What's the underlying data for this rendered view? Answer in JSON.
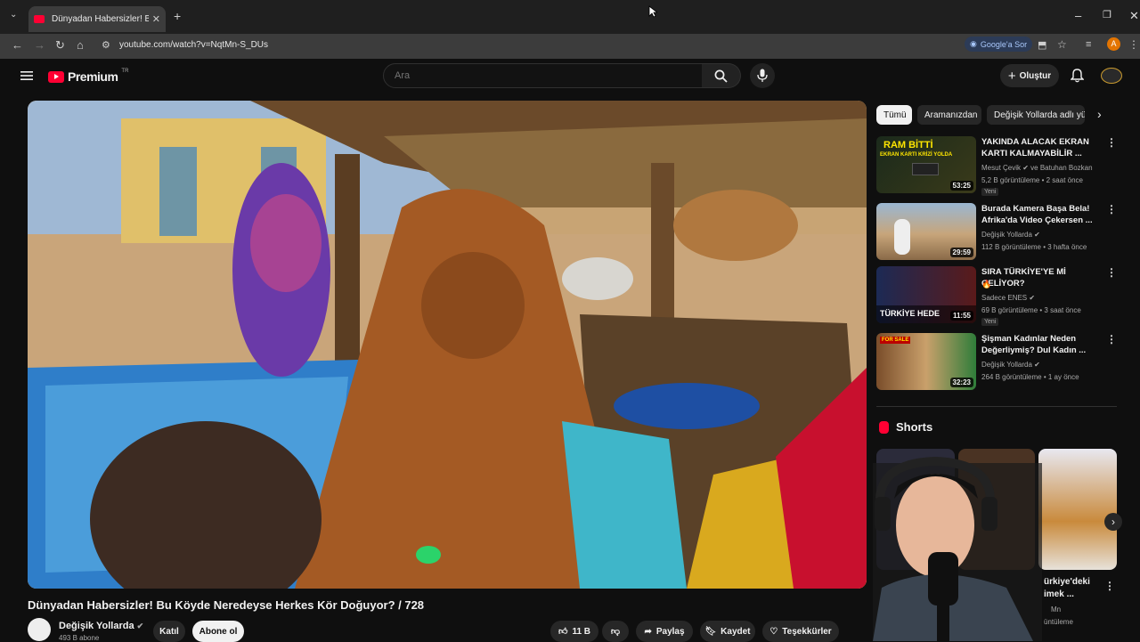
{
  "browser": {
    "tab_title": "Dünyadan Habersizler! Bu Köyde",
    "tab_close": "✕",
    "new_tab": "+",
    "url": "youtube.com/watch?v=NqtMn-S_DUs",
    "google_sor": "Google'a Sor",
    "profile_letter": "A"
  },
  "youtube": {
    "brand": "Premium",
    "brand_region": "TR",
    "search_placeholder": "Ara",
    "create_label": "Oluştur"
  },
  "video": {
    "title": "Dünyadan Habersizler! Bu Köyde Neredeyse Herkes Kör Doğuyor? / 728",
    "channel": "Değişik Yollarda",
    "subscribers": "493 B abone",
    "join_label": "Katıl",
    "subscribe_label": "Abone ol",
    "likes": "11 B",
    "share_label": "Paylaş",
    "save_label": "Kaydet",
    "thanks_label": "Teşekkürler"
  },
  "chips": [
    "Tümü",
    "Aramanızdan",
    "Değişik Yollarda adlı yük"
  ],
  "recommendations": [
    {
      "title": "YAKINDA ALACAK EKRAN KARTI KALMAYABİLİR ...",
      "channel": "Mesut Çevik",
      "collab": "ve Batuhan Bozkan",
      "meta": "5,2 B görüntüleme • 2 saat önce",
      "badge": "Yeni",
      "duration": "53:25",
      "thumb_text_1": "RAM BİTTİ",
      "thumb_text_2": "EKRAN KARTI KRİZİ YOLDA"
    },
    {
      "title": "Burada Kamera Başa Bela! Afrika'da Video Çekersen ...",
      "channel": "Değişik Yollarda",
      "collab": "",
      "meta": "112 B görüntüleme • 3 hafta önce",
      "badge": "",
      "duration": "29:59",
      "thumb_text_1": "",
      "thumb_text_2": ""
    },
    {
      "title": "SIRA TÜRKİYE'YE Mİ GELİYOR?",
      "channel": "Sadece ENES",
      "collab": "",
      "meta": "69 B görüntüleme • 3 saat önce",
      "badge": "Yeni",
      "duration": "11:55",
      "thumb_text_1": "TÜRKİYE HEDE",
      "thumb_text_2": ""
    },
    {
      "title": "Şişman Kadınlar Neden Değerliymiş? Dul Kadın ...",
      "channel": "Değişik Yollarda",
      "collab": "",
      "meta": "264 B görüntüleme • 1 ay önce",
      "badge": "",
      "duration": "32:23",
      "thumb_text_1": "FOR SALE",
      "thumb_text_2": ""
    }
  ],
  "shorts": {
    "heading": "Shorts",
    "partial_title_1": "ürkiye'deki",
    "partial_title_2": "imek ...",
    "partial_channel": "Mn",
    "partial_views": "üntüleme"
  },
  "colors": {
    "youtube_red": "#ff0033",
    "bg": "#0f0f0f",
    "chip": "#272727"
  }
}
